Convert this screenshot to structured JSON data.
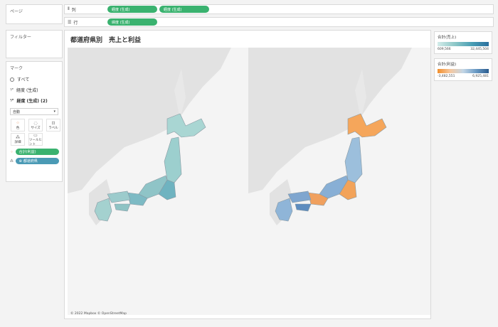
{
  "shelves": {
    "pages_label": "ページ",
    "columns": {
      "label": "列",
      "pills": [
        "経度 (生成)",
        "経度 (生成)"
      ]
    },
    "rows": {
      "label": "行",
      "pills": [
        "緯度 (生成)"
      ]
    }
  },
  "filters": {
    "label": "フィルター"
  },
  "marks": {
    "label": "マーク",
    "items": [
      "すべて",
      "経度 (生成)",
      "経度 (生成) (2)"
    ],
    "mark_type": "自動",
    "buttons": [
      "色",
      "サイズ",
      "ラベル",
      "詳細",
      "ツールヒント"
    ],
    "pills": [
      {
        "label": "合計(利益)",
        "color": "#3ab26f"
      },
      {
        "label": "都道府県",
        "color": "#4a9ab5"
      }
    ]
  },
  "sheet": {
    "title": "都道府県別　売上と利益",
    "copyright": "© 2022 Mapbox © OpenStreetMap"
  },
  "maps": [
    {
      "name": "sales",
      "colors": {
        "hokkaido": "#a9d6d3",
        "tohoku": "#9ccfce",
        "kanto": "#6fb3c0",
        "chubu": "#8fc4c7",
        "kansai": "#7dbac4",
        "chugoku": "#9ccbcc",
        "shikoku": "#8fc3c4",
        "kyushu": "#a4d1cf"
      }
    },
    {
      "name": "profit",
      "colors": {
        "hokkaido": "#f5a65b",
        "tohoku": "#9cbfdc",
        "kanto": "#f2a35a",
        "chubu": "#88afd5",
        "kansai": "#f0a05e",
        "chugoku": "#7fa6cf",
        "shikoku": "#5e8dbf",
        "kyushu": "#8fb5d8"
      }
    }
  ],
  "legends": {
    "sales": {
      "title": "合計(売上)",
      "min": "609,566",
      "max": "32,445,504"
    },
    "profit": {
      "title": "合計(利益)",
      "min": "-3,482,551",
      "max": "6,925,481"
    }
  }
}
